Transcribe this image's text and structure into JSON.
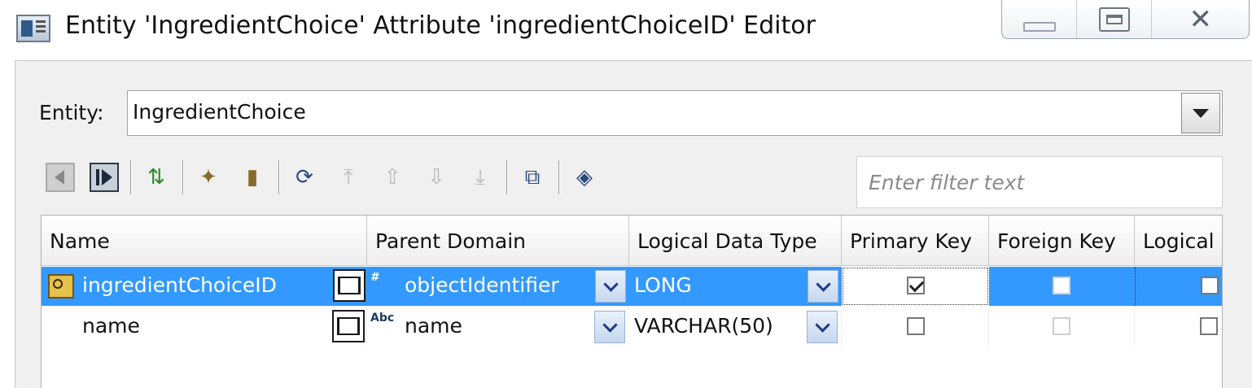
{
  "window": {
    "title": "Entity 'IngredientChoice' Attribute 'ingredientChoiceID' Editor",
    "controls": {
      "close_glyph": "✕"
    }
  },
  "entity": {
    "label": "Entity:",
    "value": "IngredientChoice"
  },
  "toolbar": {
    "icons": [
      "first-icon",
      "last-icon",
      "move-icon",
      "new-attribute-icon",
      "delete-icon",
      "reorder-icon",
      "move-top-icon",
      "move-up-icon",
      "move-down-icon",
      "move-bottom-icon",
      "properties-icon",
      "domain-icon"
    ]
  },
  "filter": {
    "placeholder": "Enter filter text"
  },
  "table": {
    "columns": [
      "Name",
      "Parent Domain",
      "Logical Data Type",
      "Primary Key",
      "Foreign Key",
      "Logical"
    ],
    "rows": [
      {
        "name": "ingredientChoiceID",
        "parent_domain": "objectIdentifier",
        "domain_icon": "#",
        "logical_data_type": "LONG",
        "primary_key": true,
        "foreign_key": false,
        "logical": false,
        "selected": true
      },
      {
        "name": "name",
        "parent_domain": "name",
        "domain_icon": "Abc",
        "logical_data_type": "VARCHAR(50)",
        "primary_key": false,
        "foreign_key": false,
        "logical": false,
        "selected": false
      }
    ]
  },
  "colors": {
    "selection": "#3399ff",
    "panel": "#f0f0f0"
  }
}
